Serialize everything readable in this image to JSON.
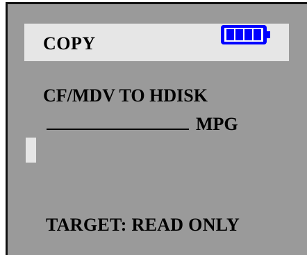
{
  "header": {
    "title": "COPY",
    "battery_icon": "battery-full-icon",
    "battery_level": 1.0,
    "battery_color": "#0000ff"
  },
  "main": {
    "operation": "CF/MDV TO HDISK",
    "file_type": "MPG",
    "target_status": "TARGET:  READ ONLY"
  },
  "colors": {
    "screen_background": "#9a9a9a",
    "title_bar": "#e6e6e6",
    "cursor": "#e6e6e6",
    "text": "#000000"
  }
}
